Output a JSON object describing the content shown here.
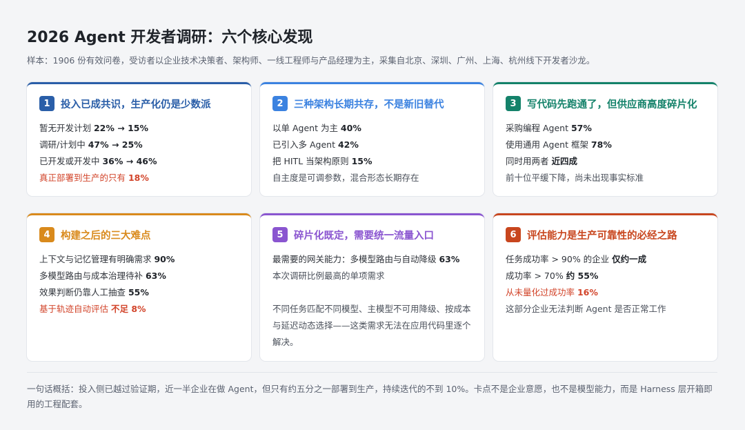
{
  "header": {
    "title": "2026 Agent 开发者调研：六个核心发现",
    "subtitle": "样本：1906 份有效问卷，受访者以企业技术决策者、架构师、一线工程师与产品经理为主，采集自北京、深圳、广州、上海、杭州线下开发者沙龙。"
  },
  "colors": {
    "card1": "#2a5ea8",
    "card2": "#3b82e0",
    "card3": "#14826a",
    "card4": "#d98a1c",
    "card5": "#8a55d0",
    "card6": "#c8461e",
    "highlight": "#d2442a"
  },
  "cards": [
    {
      "num": "1",
      "title": "投入已成共识，生产化仍是少数派",
      "lines": [
        {
          "text": "暂无开发计划 ",
          "value": "22% → 15%"
        },
        {
          "text": "调研/计划中 ",
          "value": "47% → 25%"
        },
        {
          "text": "已开发或开发中 ",
          "value": "36% → 46%"
        },
        {
          "text": "真正部署到生产的只有 ",
          "value": "18%"
        }
      ]
    },
    {
      "num": "2",
      "title": "三种架构长期共存，不是新旧替代",
      "lines": [
        {
          "text": "以单 Agent 为主 ",
          "value": "40%"
        },
        {
          "text": "已引入多 Agent ",
          "value": "42%"
        },
        {
          "text": "把 HITL 当架构原则 ",
          "value": "15%"
        },
        {
          "text": "自主度是可调参数，混合形态长期存在"
        }
      ]
    },
    {
      "num": "3",
      "title": "写代码先跑通了，但供应商高度碎片化",
      "lines": [
        {
          "text": "采购编程 Agent ",
          "value": "57%"
        },
        {
          "text": "使用通用 Agent 框架 ",
          "value": "78%"
        },
        {
          "text": "同时用两者 ",
          "value": "近四成"
        },
        {
          "text": "前十位平缓下降，尚未出现事实标准"
        }
      ]
    },
    {
      "num": "4",
      "title": "构建之后的三大难点",
      "lines": [
        {
          "text": "上下文与记忆管理有明确需求 ",
          "value": "90%"
        },
        {
          "text": "多模型路由与成本治理待补 ",
          "value": "63%"
        },
        {
          "text": "效果判断仍靠人工抽查 ",
          "value": "55%"
        },
        {
          "text": "基于轨迹自动评估 ",
          "value": "不足 8%"
        }
      ]
    },
    {
      "num": "5",
      "title": "碎片化既定，需要统一流量入口",
      "lines": [
        {
          "text": "最需要的网关能力：多模型路由与自动降级 ",
          "value": "63%"
        },
        {
          "text": "本次调研比例最高的单项需求"
        }
      ],
      "paragraph": "不同任务匹配不同模型、主模型不可用降级、按成本与延迟动态选择——这类需求无法在应用代码里逐个解决。"
    },
    {
      "num": "6",
      "title": "评估能力是生产可靠性的必经之路",
      "lines": [
        {
          "text": "任务成功率 > 90% 的企业 ",
          "value": "仅约一成"
        },
        {
          "text": "成功率 > 70% ",
          "value": "约 55%"
        },
        {
          "text": "从未量化过成功率 ",
          "value": "16%"
        },
        {
          "text": "这部分企业无法判断 Agent 是否正常工作"
        }
      ]
    }
  ],
  "footer": {
    "summary": "一句话概括：投入侧已越过验证期，近一半企业在做 Agent，但只有约五分之一部署到生产，持续迭代的不到 10%。卡点不是企业意愿，也不是模型能力，而是 Harness 层开箱即用的工程配套。"
  }
}
